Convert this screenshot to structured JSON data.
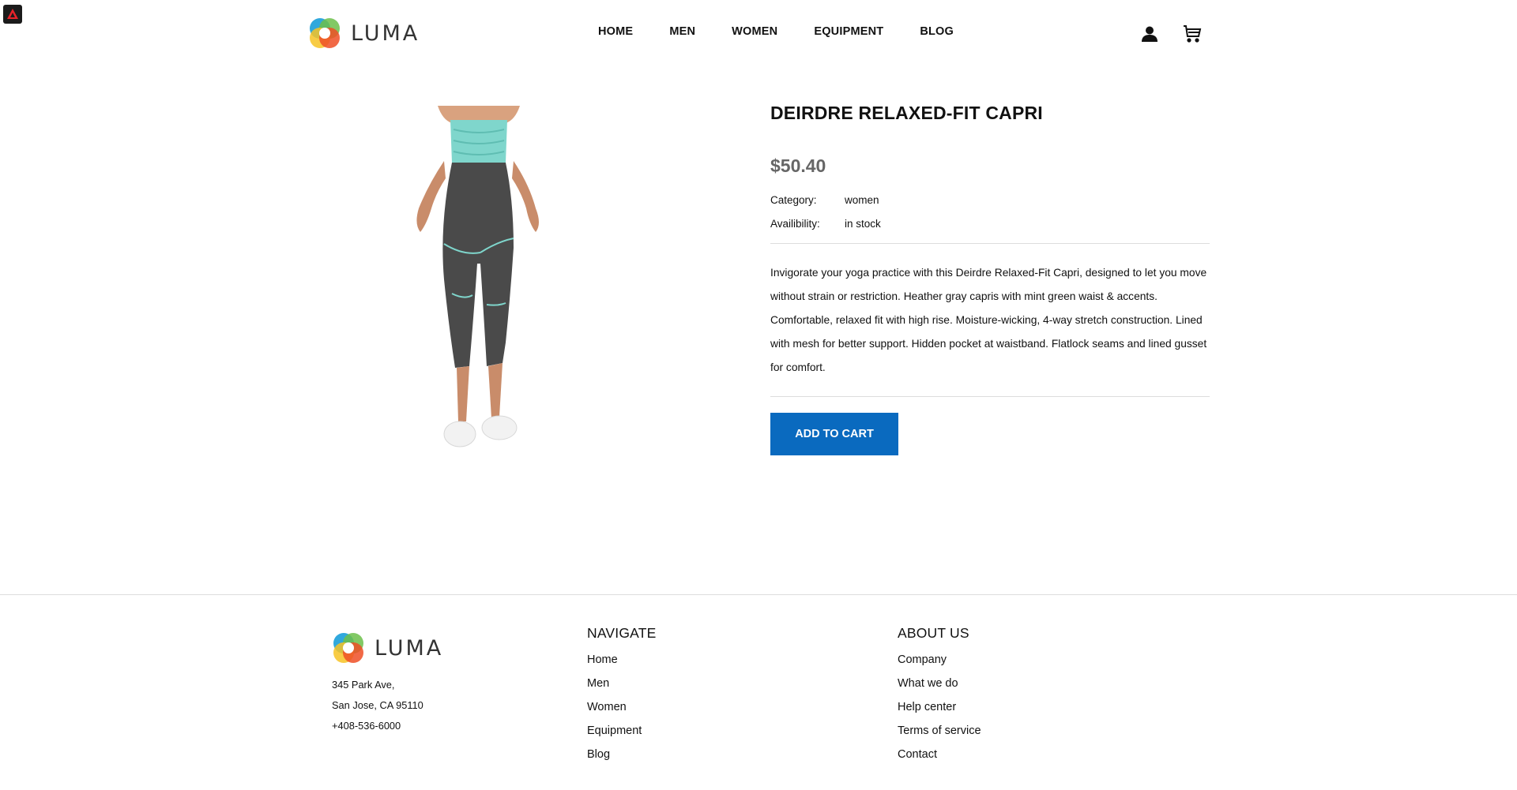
{
  "brand": {
    "name": "LUMA"
  },
  "header": {
    "nav": [
      {
        "label": "HOME"
      },
      {
        "label": "MEN"
      },
      {
        "label": "WOMEN"
      },
      {
        "label": "EQUIPMENT"
      },
      {
        "label": "BLOG"
      }
    ],
    "icons": [
      "account-icon",
      "cart-icon"
    ]
  },
  "product": {
    "title": "DEIRDRE RELAXED-FIT CAPRI",
    "price": "$50.40",
    "category_label": "Category:",
    "category_value": "women",
    "availability_label": "Availibility:",
    "availability_value": "in stock",
    "description": "Invigorate your yoga practice with this Deirdre Relaxed-Fit Capri, designed to let you move without strain or restriction. Heather gray capris with mint green waist & accents. Comfortable, relaxed fit with high rise. Moisture-wicking, 4-way stretch construction. Lined with mesh for better support. Hidden pocket at waistband. Flatlock seams and lined gusset for comfort.",
    "add_to_cart": "ADD TO CART"
  },
  "footer": {
    "address": [
      "345 Park Ave,",
      "San Jose, CA 95110",
      "+408-536-6000"
    ],
    "navigate": {
      "heading": "NAVIGATE",
      "links": [
        "Home",
        "Men",
        "Women",
        "Equipment",
        "Blog"
      ]
    },
    "about": {
      "heading": "ABOUT US",
      "links": [
        "Company",
        "What we do",
        "Help center",
        "Terms of service",
        "Contact"
      ]
    }
  },
  "colors": {
    "accent": "#0a6abf",
    "price": "#666666",
    "pants": "#4a4a4a",
    "waistband": "#7fd6cc"
  }
}
